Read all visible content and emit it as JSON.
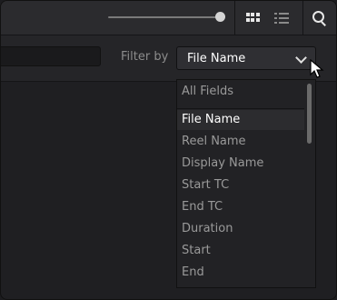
{
  "toolbar": {
    "zoom_slider": {
      "level": 0.95
    },
    "view_icons": [
      "grid-view-icon",
      "list-view-icon",
      "search-icon"
    ],
    "active_view": "grid"
  },
  "filter": {
    "search_value": "",
    "label": "Filter by",
    "selected": "File Name",
    "options": [
      "All Fields",
      "File Name",
      "Reel Name",
      "Display Name",
      "Start TC",
      "End TC",
      "Duration",
      "Start",
      "End"
    ]
  },
  "colors": {
    "background": "#1f1f22",
    "toolbar": "#2b2b2e",
    "text_primary": "#ffffff",
    "text_secondary": "#9a9a9a"
  }
}
